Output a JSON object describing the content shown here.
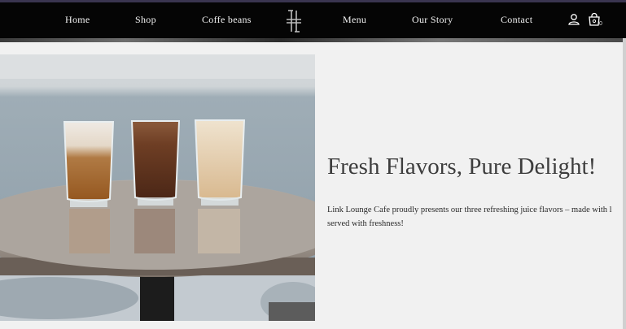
{
  "nav": {
    "links": [
      "Home",
      "Shop",
      "Coffe beans",
      "Menu",
      "Our Story",
      "Contact"
    ],
    "logo_icon": "cafe-monogram-logo",
    "account_icon": "user-icon",
    "cart_icon": "shopping-bag-icon",
    "cart_count": "0"
  },
  "hero": {
    "title": "Fresh Flavors, Pure Delight!",
    "description_line1": "Link Lounge Cafe proudly presents our three refreshing juice flavors – made with l",
    "description_line2": "served with freshness!",
    "image_subject": "three iced drinks on a marble table"
  },
  "colors": {
    "nav_background": "#050505",
    "page_background": "#f1f1f1",
    "headline": "#3d3d3d"
  }
}
